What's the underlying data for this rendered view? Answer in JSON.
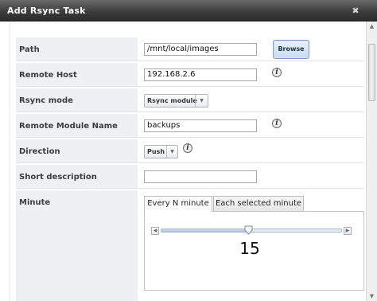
{
  "dialog": {
    "title": "Add Rsync Task",
    "close_glyph": "✖"
  },
  "form": {
    "path": {
      "label": "Path",
      "value": "/mnt/local/images",
      "browse_label": "Browse"
    },
    "remote_host": {
      "label": "Remote Host",
      "value": "192.168.2.6",
      "info_icon": "info-icon"
    },
    "rsync_mode": {
      "label": "Rsync mode",
      "value": "Rsync module"
    },
    "remote_module": {
      "label": "Remote Module Name",
      "value": "backups",
      "info_icon": "info-icon"
    },
    "direction": {
      "label": "Direction",
      "value": "Push",
      "info_icon": "info-icon"
    },
    "short_description": {
      "label": "Short description",
      "value": ""
    },
    "minute": {
      "label": "Minute",
      "tabs": [
        {
          "label": "Every N minute",
          "active": true
        },
        {
          "label": "Each selected minute",
          "active": false
        }
      ],
      "slider_value": "15",
      "slider_min": 1,
      "slider_max": 30
    }
  },
  "colors": {
    "titlebar": "#3d3d3d",
    "label_bg": "#eef0f2",
    "accent": "#7d9bc2"
  }
}
